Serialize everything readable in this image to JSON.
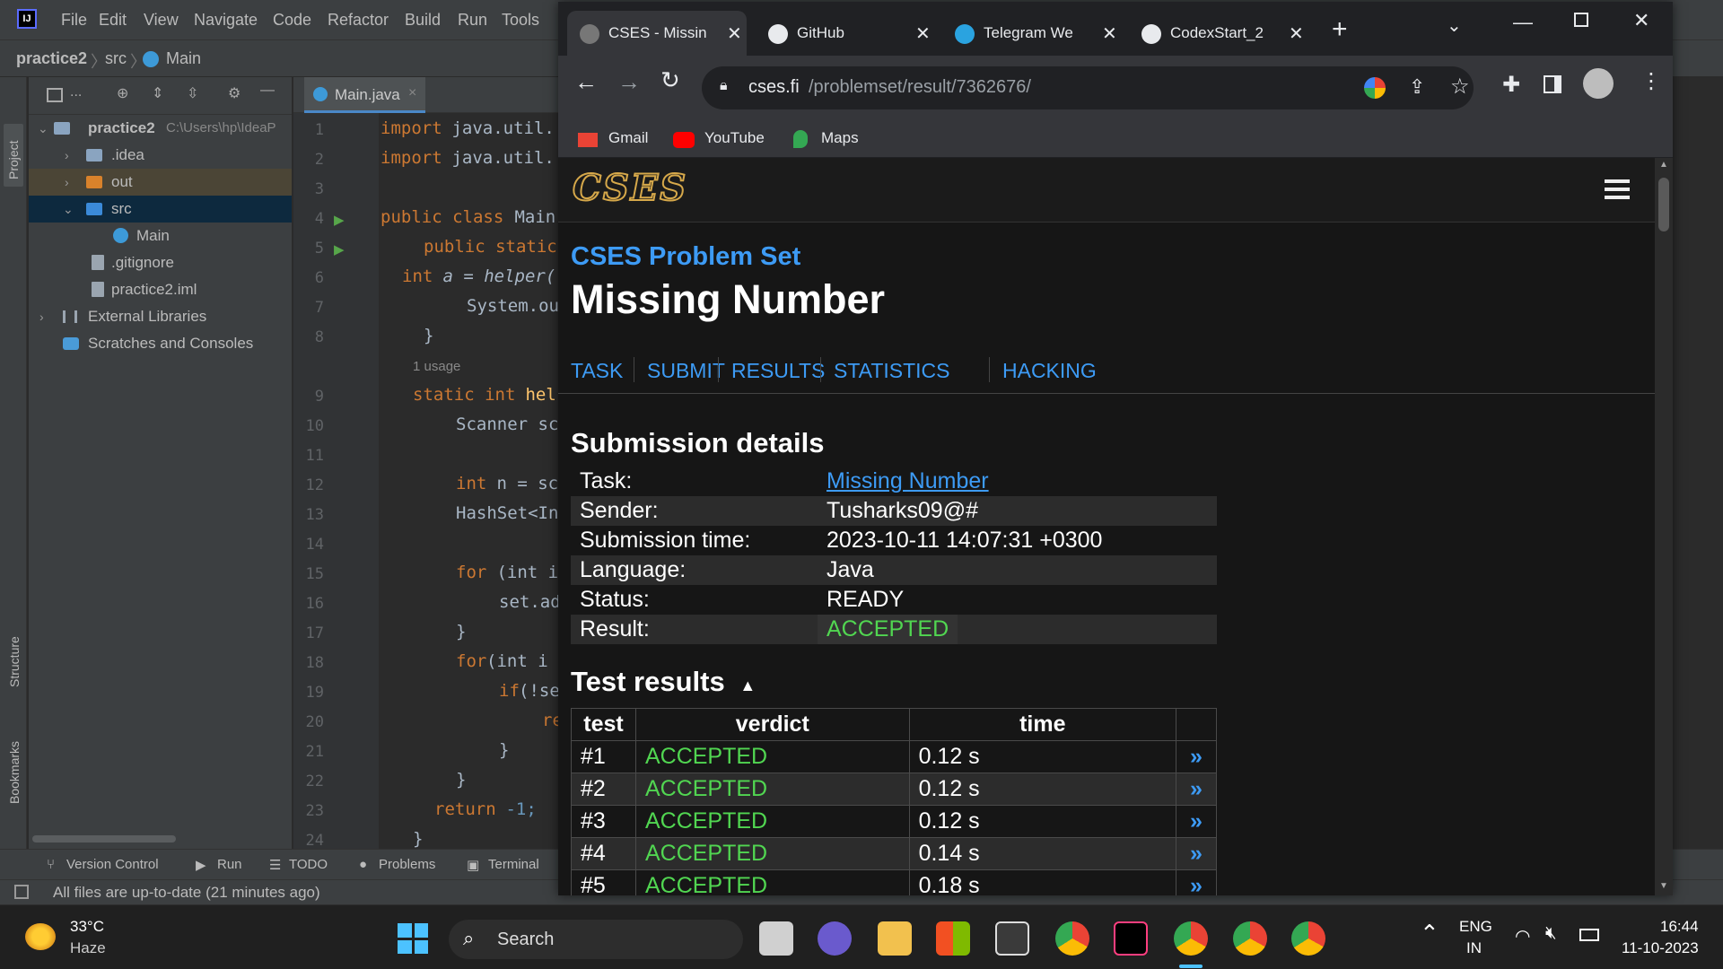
{
  "ide": {
    "menu": [
      "File",
      "Edit",
      "View",
      "Navigate",
      "Code",
      "Refactor",
      "Build",
      "Run",
      "Tools"
    ],
    "breadcrumb": {
      "project": "practice2",
      "src": "src",
      "cls": "Main"
    },
    "project_label": "Project",
    "structure_label": "Structure",
    "bookmarks_label": "Bookmarks",
    "project_dropdown": "...",
    "tree": {
      "root": "practice2",
      "root_path": "C:\\Users\\hp\\IdeaP",
      "idea": ".idea",
      "out": "out",
      "src": "src",
      "main": "Main",
      "gitignore": ".gitignore",
      "iml": "practice2.iml",
      "extlibs": "External Libraries",
      "scratches": "Scratches and Consoles"
    },
    "tab": "Main.java",
    "line_numbers": [
      "1",
      "2",
      "3",
      "4",
      "5",
      "6",
      "7",
      "8",
      "9",
      "10",
      "11",
      "12",
      "13",
      "14",
      "15",
      "16",
      "17",
      "18",
      "19",
      "20",
      "21",
      "22",
      "23",
      "24"
    ],
    "code": {
      "l1a": "import",
      "l1b": " java.util.",
      "l2a": "import",
      "l2b": " java.util.",
      "l4a": "public class",
      "l4b": " Main",
      "l5a": "public static",
      "l6a": "int",
      "l6b": " a = helper(",
      "l7": "System.ou",
      "l8": "}",
      "usage": "1 usage",
      "l9a": "static int",
      "l9b": " hel",
      "l10": "Scanner sc",
      "l12a": "int",
      "l12b": " n = sc",
      "l13": "HashSet<In",
      "l15a": "for",
      "l15b": " (int i",
      "l16": "set.ad",
      "l17": "}",
      "l18a": "for",
      "l18b": "(int i",
      "l19a": "if",
      "l19b": "(!se",
      "l20": "re",
      "l21": "}",
      "l22": "}",
      "l23a": "return",
      "l23b": " -1;",
      "l24": "}"
    },
    "bottom_tabs": {
      "vc": "Version Control",
      "run": "Run",
      "todo": "TODO",
      "problems": "Problems",
      "terminal": "Terminal"
    },
    "status": "All files are up-to-date (21 minutes ago)"
  },
  "browser": {
    "tabs": [
      {
        "title": "CSES - Missin",
        "active": true
      },
      {
        "title": "GitHub",
        "active": false
      },
      {
        "title": "Telegram We",
        "active": false
      },
      {
        "title": "CodexStart_2",
        "active": false
      }
    ],
    "url_host": "cses.fi",
    "url_path": "/problemset/result/7362676/",
    "bookmarks": [
      "Gmail",
      "YouTube",
      "Maps"
    ]
  },
  "page": {
    "logo": "CSES",
    "section": "CSES Problem Set",
    "title": "Missing Number",
    "nav": [
      "TASK",
      "SUBMIT",
      "RESULTS",
      "STATISTICS",
      "HACKING"
    ],
    "details_heading": "Submission details",
    "details": [
      {
        "label": "Task:",
        "value": "Missing Number"
      },
      {
        "label": "Sender:",
        "value": "Tusharks09@#"
      },
      {
        "label": "Submission time:",
        "value": "2023-10-11 14:07:31 +0300"
      },
      {
        "label": "Language:",
        "value": "Java"
      },
      {
        "label": "Status:",
        "value": "READY"
      },
      {
        "label": "Result:",
        "value": "ACCEPTED"
      }
    ],
    "tests_heading": "Test results",
    "columns": [
      "test",
      "verdict",
      "time"
    ],
    "tests": [
      {
        "test": "#1",
        "verdict": "ACCEPTED",
        "time": "0.12 s"
      },
      {
        "test": "#2",
        "verdict": "ACCEPTED",
        "time": "0.12 s"
      },
      {
        "test": "#3",
        "verdict": "ACCEPTED",
        "time": "0.12 s"
      },
      {
        "test": "#4",
        "verdict": "ACCEPTED",
        "time": "0.14 s"
      },
      {
        "test": "#5",
        "verdict": "ACCEPTED",
        "time": "0.18 s"
      }
    ]
  },
  "taskbar": {
    "temp": "33°C",
    "weather": "Haze",
    "search": "Search",
    "lang1": "ENG",
    "lang2": "IN",
    "time": "16:44",
    "date": "11-10-2023"
  },
  "colors": {
    "accepted": "#51d651",
    "link": "#3d9bf5",
    "ide_bg": "#2b2b2b",
    "page_bg": "#161616"
  }
}
